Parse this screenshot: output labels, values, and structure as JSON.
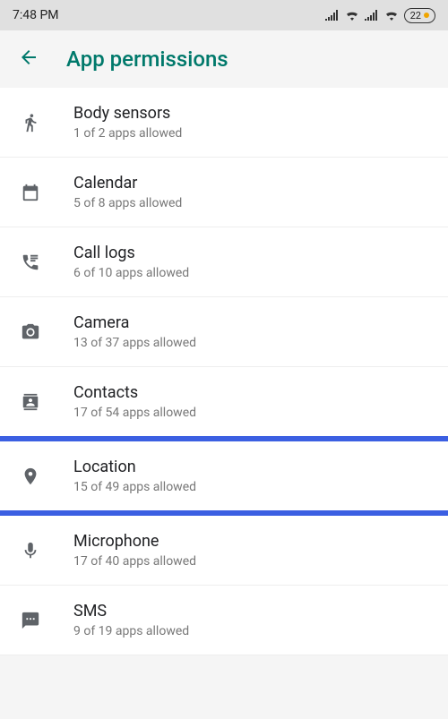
{
  "status": {
    "time": "7:48 PM",
    "battery": "22"
  },
  "header": {
    "title": "App permissions"
  },
  "items": [
    {
      "title": "Body sensors",
      "sub": "1 of 2 apps allowed"
    },
    {
      "title": "Calendar",
      "sub": "5 of 8 apps allowed"
    },
    {
      "title": "Call logs",
      "sub": "6 of 10 apps allowed"
    },
    {
      "title": "Camera",
      "sub": "13 of 37 apps allowed"
    },
    {
      "title": "Contacts",
      "sub": "17 of 54 apps allowed"
    },
    {
      "title": "Location",
      "sub": "15 of 49 apps allowed"
    },
    {
      "title": "Microphone",
      "sub": "17 of 40 apps allowed"
    },
    {
      "title": "SMS",
      "sub": "9 of 19 apps allowed"
    }
  ]
}
